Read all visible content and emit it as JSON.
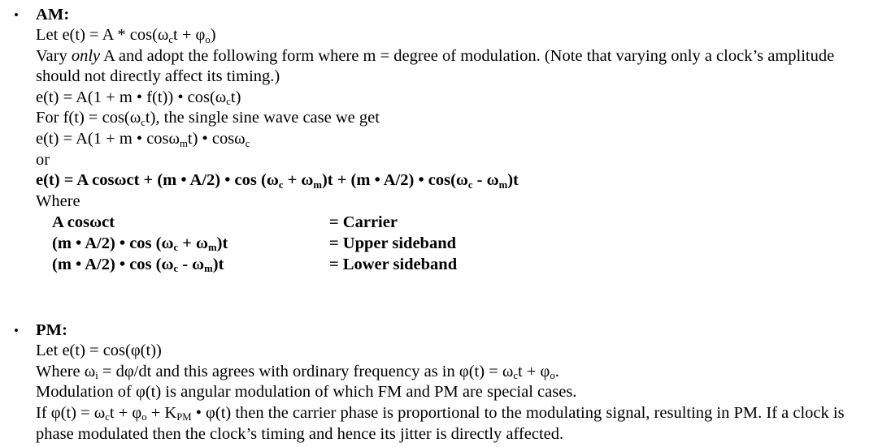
{
  "document": {
    "bullet_glyph": "•",
    "sections": [
      {
        "id": "am",
        "heading": "AM:",
        "lines": {
          "let_equation_pre": "Let e(t) = A * cos(ω",
          "let_equation_sub1": "c",
          "let_equation_mid": "t + φ",
          "let_equation_sub2": "o",
          "let_equation_post": ")",
          "vary_pre": "Vary ",
          "vary_italic": "only",
          "vary_post": " A and adopt the following form where m = degree of modulation. (Note that varying only a clock’s amplitude should not directly affect its timing.)",
          "eq_form_pre": "e(t) = A(1 + m • f(t)) • cos(ω",
          "eq_form_sub": "c",
          "eq_form_post": "t)",
          "for_f_pre": "For f(t) = cos(ω",
          "for_f_sub": "c",
          "for_f_post": "t), the single sine wave case we get",
          "eq_single_pre": "e(t) = A(1 + m • cosω",
          "eq_single_sub1": "m",
          "eq_single_mid": "t) • cosω",
          "eq_single_sub2": "c",
          "eq_single_post": "",
          "or_text": "or",
          "expanded_pre": "e(t) = A cosωct + (m • A/2) • cos (ω",
          "expanded_sub1": "c",
          "expanded_mid1": " + ω",
          "expanded_sub2": "m",
          "expanded_mid2": ")t + (m • A/2) • cos(ω",
          "expanded_sub3": "c",
          "expanded_mid3": " - ω",
          "expanded_sub4": "m",
          "expanded_post": ")t",
          "where_text": "Where"
        },
        "term_table": [
          {
            "term_pre": "A cosωct",
            "term_sub1": "",
            "term_mid": "",
            "term_sub2": "",
            "term_post": "",
            "definition": "= Carrier"
          },
          {
            "term_pre": "(m • A/2) • cos (ω",
            "term_sub1": "c",
            "term_mid": " + ω",
            "term_sub2": "m",
            "term_post": ")t",
            "definition": "= Upper sideband"
          },
          {
            "term_pre": "(m • A/2) • cos (ω",
            "term_sub1": "c",
            "term_mid": "  - ω",
            "term_sub2": "m",
            "term_post": ")t",
            "definition": "= Lower sideband"
          }
        ]
      },
      {
        "id": "pm",
        "heading": "PM:",
        "lines": {
          "let_equation": "Let e(t) = cos(φ(t))",
          "where_pre": "Where ω",
          "where_sub1": "i",
          "where_mid": " = dφ/dt and this agrees with ordinary frequency as in φ(t) = ω",
          "where_sub2": "c",
          "where_mid2": "t + φ",
          "where_sub3": "o",
          "where_post": ".",
          "modulation_text": "Modulation of φ(t) is angular modulation of which FM and PM are special cases.",
          "if_pre": "If φ(t) = ω",
          "if_sub1": "c",
          "if_mid1": "t + φ",
          "if_sub2": "o",
          "if_mid2": " + K",
          "if_sub3": "PM",
          "if_post": " • φ(t) then the carrier phase is proportional to the modulating signal, resulting in PM.  If a clock is phase modulated then the clock’s timing and hence its jitter is directly affected."
        }
      }
    ]
  }
}
